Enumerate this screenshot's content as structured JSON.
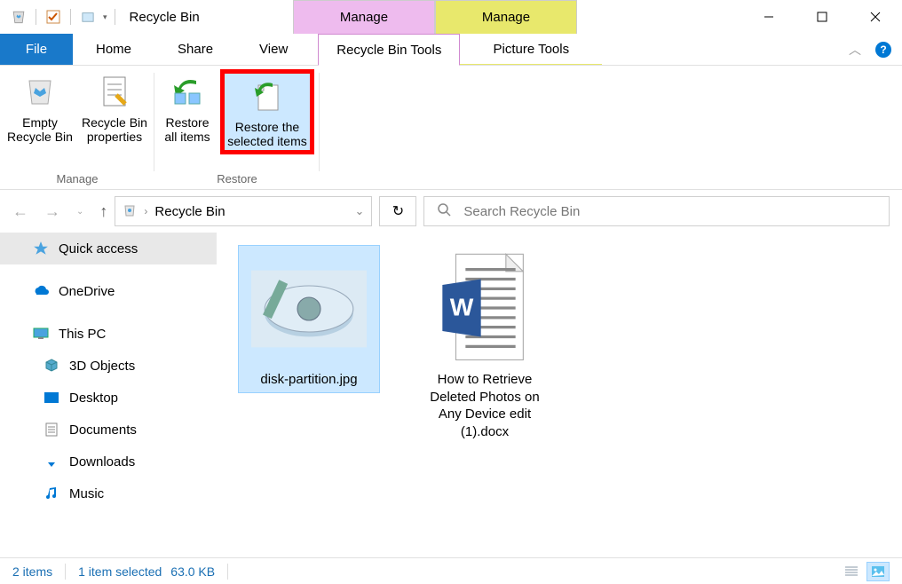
{
  "window": {
    "title": "Recycle Bin",
    "tool_tabs": [
      "Manage",
      "Manage"
    ]
  },
  "tabs": {
    "file": "File",
    "items": [
      "Home",
      "Share",
      "View"
    ],
    "tool_items": [
      "Recycle Bin Tools",
      "Picture Tools"
    ]
  },
  "ribbon": {
    "groups": [
      {
        "label": "Manage",
        "items": [
          {
            "icon": "recycle-bin-empty-icon",
            "line1": "Empty",
            "line2": "Recycle Bin"
          },
          {
            "icon": "properties-icon",
            "line1": "Recycle Bin",
            "line2": "properties"
          }
        ]
      },
      {
        "label": "Restore",
        "items": [
          {
            "icon": "restore-all-icon",
            "line1": "Restore",
            "line2": "all items"
          },
          {
            "icon": "restore-selected-icon",
            "line1": "Restore the",
            "line2": "selected items",
            "highlight": true
          }
        ]
      }
    ]
  },
  "address": {
    "location": "Recycle Bin"
  },
  "search": {
    "placeholder": "Search Recycle Bin"
  },
  "sidebar": {
    "quick": "Quick access",
    "onedrive": "OneDrive",
    "thispc": "This PC",
    "sub": [
      "3D Objects",
      "Desktop",
      "Documents",
      "Downloads",
      "Music"
    ]
  },
  "files": [
    {
      "name": "disk-partition.jpg",
      "type": "image",
      "selected": true
    },
    {
      "name": "How to Retrieve Deleted Photos on Any Device edit (1).docx",
      "type": "docx",
      "selected": false
    }
  ],
  "status": {
    "count": "2 items",
    "selected": "1 item selected",
    "size": "63.0 KB"
  }
}
